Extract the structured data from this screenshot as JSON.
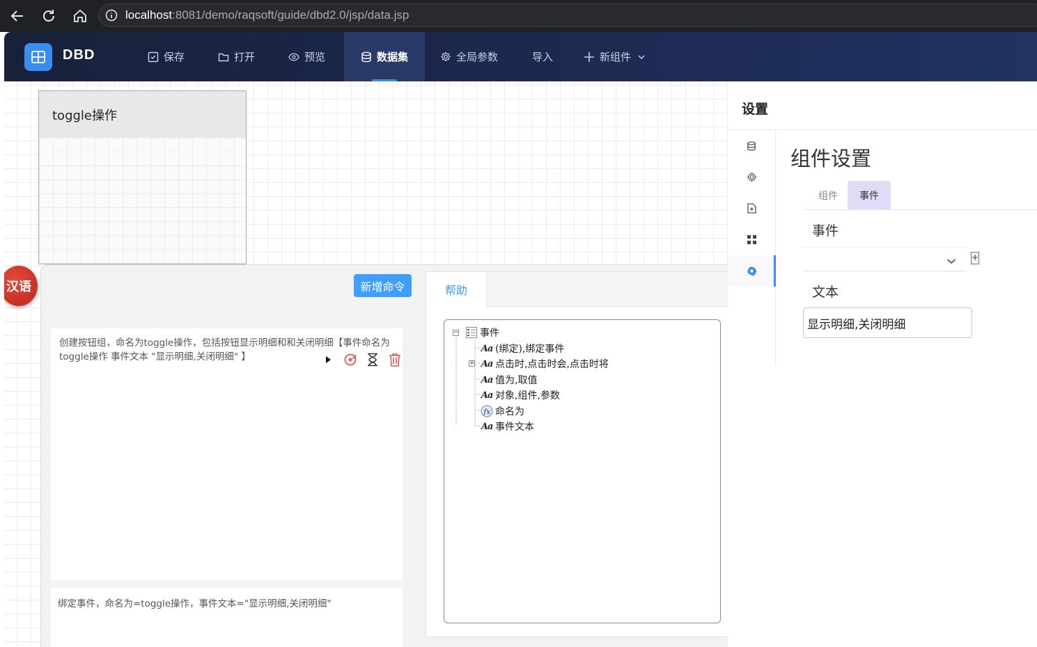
{
  "browser": {
    "url_host": "localhost",
    "url_path": ":8081/demo/raqsoft/guide/dbd2.0/jsp/data.jsp"
  },
  "app": {
    "logo_text": "DBD",
    "nav": [
      {
        "label": "保存",
        "icon": "save-icon"
      },
      {
        "label": "打开",
        "icon": "folder-icon"
      },
      {
        "label": "预览",
        "icon": "eye-icon"
      },
      {
        "label": "数据集",
        "icon": "database-icon",
        "active": true
      },
      {
        "label": "全局参数",
        "icon": "gear-icon"
      },
      {
        "label": "导入",
        "icon": ""
      },
      {
        "label": "新组件",
        "icon": "plus-icon",
        "dropdown": true
      }
    ]
  },
  "canvas": {
    "widget_title": "toggle操作",
    "lang_badge": "汉语"
  },
  "command": {
    "new_button": "新增命令",
    "text": "创建按钮组，命名为toggle操作，包括按钮显示明细和和关闭明细【事件命名为 toggle操作 事件文本 \"显示明细,关闭明细\" 】",
    "output": "绑定事件，命名为=toggle操作，事件文本=\"显示明细,关闭明细\""
  },
  "help": {
    "tab": "帮助",
    "tree_root": "事件",
    "tree_items": [
      {
        "label": "(绑定),绑定事件",
        "icon": "aa-icon"
      },
      {
        "label": "点击时,点击时会,点击时将",
        "icon": "aa-icon",
        "expandable": true
      },
      {
        "label": "值为,取值",
        "icon": "aa-icon"
      },
      {
        "label": "对象,组件,参数",
        "icon": "aa-icon"
      },
      {
        "label": "命名为",
        "icon": "function-icon"
      },
      {
        "label": "事件文本",
        "icon": "aa-icon"
      }
    ]
  },
  "settings": {
    "title": "设置",
    "component_title": "组件设置",
    "tabs": [
      {
        "label": "组件",
        "active": false
      },
      {
        "label": "事件",
        "active": true
      }
    ],
    "event_label": "事件",
    "event_value": "",
    "text_label": "文本",
    "text_value": "显示明细,关闭明细",
    "add_symbol": "+"
  },
  "colors": {
    "accent": "#409eff",
    "header_dark": "#18213a",
    "badge_red": "#c8301f"
  }
}
